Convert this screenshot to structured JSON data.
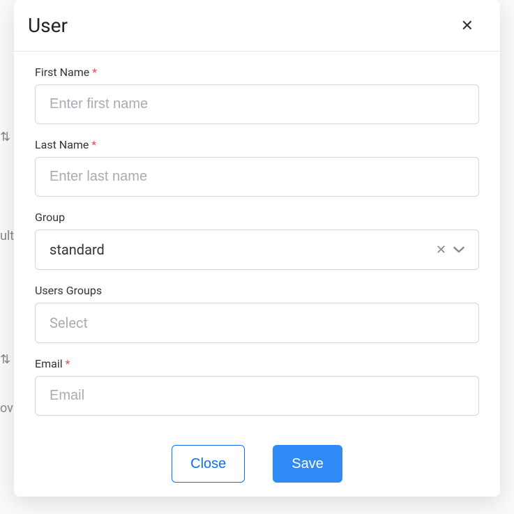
{
  "modal": {
    "title": "User",
    "fields": {
      "firstName": {
        "label": "First Name",
        "required": true,
        "placeholder": "Enter first name",
        "value": ""
      },
      "lastName": {
        "label": "Last Name",
        "required": true,
        "placeholder": "Enter last name",
        "value": ""
      },
      "group": {
        "label": "Group",
        "required": false,
        "selected": "standard"
      },
      "usersGroups": {
        "label": "Users Groups",
        "required": false,
        "placeholder": "Select"
      },
      "email": {
        "label": "Email",
        "required": true,
        "placeholder": "Email",
        "value": ""
      }
    },
    "buttons": {
      "close": "Close",
      "save": "Save"
    },
    "requiredMark": "*"
  }
}
